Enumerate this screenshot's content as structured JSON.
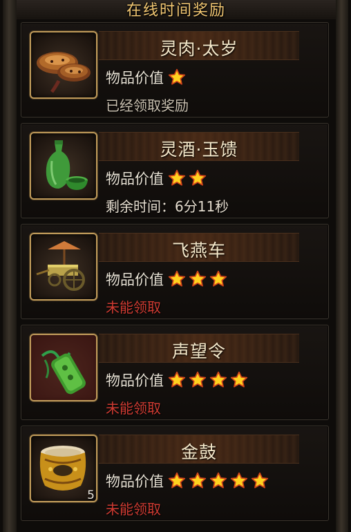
{
  "panel": {
    "title": "在线时间奖励"
  },
  "colors": {
    "title_gold": "#f2c772",
    "star_gold": "#ffd21f",
    "status_red": "#cf3b32"
  },
  "rewards": [
    {
      "name": "灵肉·太岁",
      "value_label": "物品价值",
      "stars": 1,
      "status": "已经领取奖励",
      "status_type": "claimed",
      "icon": "lingzhi-mushroom-icon",
      "count": ""
    },
    {
      "name": "灵酒·玉馈",
      "value_label": "物品价值",
      "stars": 2,
      "status": "剩余时间：6分11秒",
      "status_type": "timer",
      "icon": "jade-wine-bottle-icon",
      "count": ""
    },
    {
      "name": "飞燕车",
      "value_label": "物品价值",
      "stars": 3,
      "status": "未能领取",
      "status_type": "unavailable",
      "icon": "cart-icon",
      "count": ""
    },
    {
      "name": "声望令",
      "value_label": "物品价值",
      "stars": 4,
      "status": "未能领取",
      "status_type": "unavailable",
      "icon": "jade-token-icon",
      "count": ""
    },
    {
      "name": "金鼓",
      "value_label": "物品价值",
      "stars": 5,
      "status": "未能领取",
      "status_type": "unavailable",
      "icon": "golden-drum-icon",
      "count": "5"
    }
  ]
}
